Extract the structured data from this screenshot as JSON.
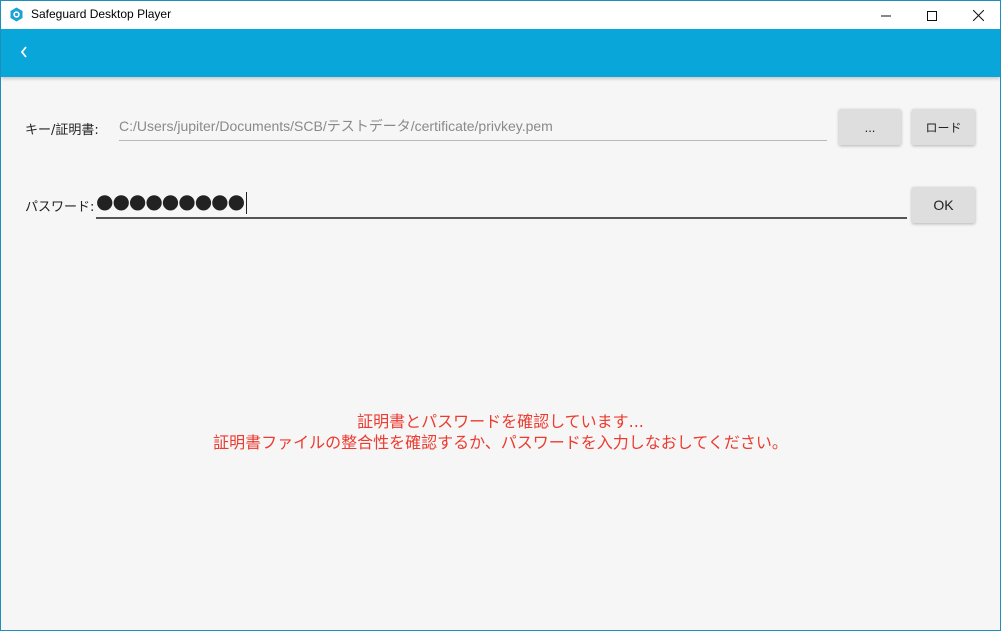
{
  "window": {
    "title": "Safeguard Desktop Player",
    "controls": {
      "minimize_icon": "minimize-icon",
      "maximize_icon": "maximize-icon",
      "close_icon": "close-icon"
    }
  },
  "appbar": {
    "color": "#09a6d9",
    "back_icon": "chevron-left-icon"
  },
  "key_row": {
    "label": "キー/証明書:",
    "path_value": "C:/Users/jupiter/Documents/SCB/テストデータ/certificate/privkey.pem",
    "browse_label": "...",
    "load_label": "ロード"
  },
  "password_row": {
    "label": "パスワード:",
    "masked_value": "●●●●●●●●●",
    "ok_label": "OK"
  },
  "error": {
    "color": "#ec3b2f",
    "line1": "証明書とパスワードを確認しています...",
    "line2": "証明書ファイルの整合性を確認するか、パスワードを入力しなおしてください。"
  }
}
